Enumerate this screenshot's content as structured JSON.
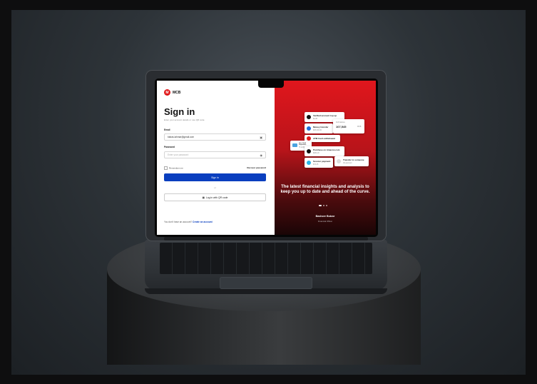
{
  "brand": {
    "logo_letter": "M",
    "name": "MCB"
  },
  "signin": {
    "title": "Sign in",
    "subtitle": "Enter your account details or use QR code",
    "email_label": "Email",
    "email_value": "babas.lahmar@gmail.com",
    "password_label": "Password",
    "password_placeholder": "Enter your password",
    "remember_label": "Remember me",
    "forgot_label": "Recover password",
    "submit_label": "Sign in",
    "or_label": "or",
    "qr_label": "Log in with QR code",
    "signup_prompt": "You don't have an account?",
    "signup_link": "Create an account"
  },
  "promo": {
    "cards": {
      "c1_title": "Verified account top up",
      "c1_amount": "$4.28",
      "c2_title": "Money transfer",
      "c2_amount": "$25,000.00",
      "c3_label": "Full balance",
      "c3_amount": "107,545",
      "c3_tag": "MCB",
      "c4_title": "ATM Cash withdrawal",
      "c5_title": "Visa Gold Payments",
      "c5_sub": "*0 1234",
      "c6_title": "Purchase on Amazon.com",
      "c6_amount": "$264.20",
      "c7_title": "Scooter payment",
      "c7_amount": "$74.25",
      "c8_title": "Transfer to someone",
      "c8_sub": "Via account"
    },
    "headline": "The latest financial insights and analysis to keep you up to date and ahead of the curve.",
    "person_name": "Bashoer Butzor",
    "person_role": "Financial Officer"
  },
  "colors": {
    "accent_red": "#e0191b",
    "button_blue": "#0a3fbf"
  }
}
